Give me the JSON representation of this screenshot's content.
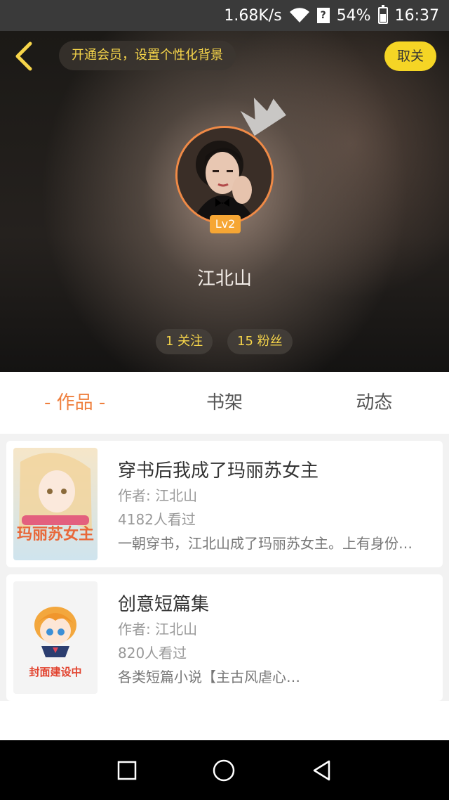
{
  "status_bar": {
    "network_speed": "1.68K/s",
    "battery_percent": "54%",
    "time": "16:37",
    "icons": [
      "wifi-icon",
      "sim-unknown-icon",
      "battery-icon"
    ]
  },
  "header": {
    "vip_tip": "开通会员，设置个性化背景",
    "cancel_label": "取关",
    "level": "Lv2",
    "username": "江北山",
    "follow_stat": "1 关注",
    "fans_stat": "15 粉丝"
  },
  "tabs": [
    {
      "label": "- 作品 -",
      "active": true
    },
    {
      "label": "书架",
      "active": false
    },
    {
      "label": "动态",
      "active": false
    }
  ],
  "books": [
    {
      "title": "穿书后我成了玛丽苏女主",
      "author": "作者: 江北山",
      "views": "4182人看过",
      "desc": "一朝穿书，江北山成了玛丽苏女主。上有身份…",
      "cover_text": "玛丽苏女主"
    },
    {
      "title": "创意短篇集",
      "author": "作者: 江北山",
      "views": "820人看过",
      "desc": "各类短篇小说【主古风虐心…",
      "cover_text": "封面建设中"
    }
  ],
  "colors": {
    "accent_orange": "#ef7f3d",
    "accent_yellow": "#f5d525",
    "level_badge": "#f6a634"
  }
}
